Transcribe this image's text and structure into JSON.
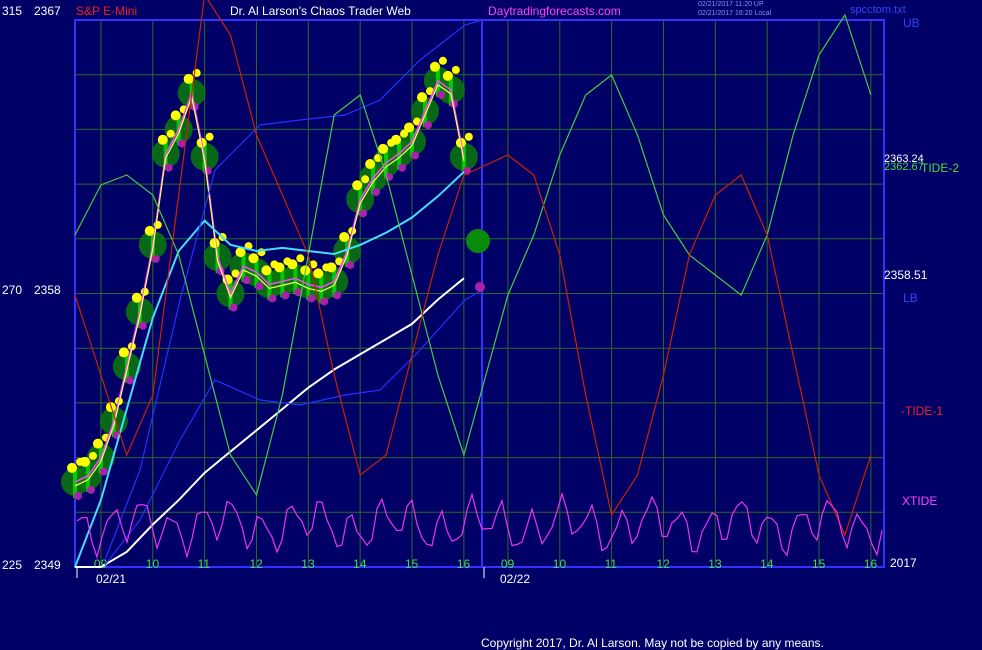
{
  "header": {
    "left_scale": "315",
    "left_price": "2367",
    "instrument": "S&P E-Mini",
    "site_title": "Dr. Al Larson's Chaos Trader Web",
    "site_link": "Daytradingforecasts.com",
    "timestamp_1": "02/21/2017 11:20 UP",
    "timestamp_2": "02/21/2017 16:20 Local",
    "file_name": "spcctom.txt"
  },
  "footer": {
    "copyright": "Copyright 2017, Dr. Al Larson. May not be copied by any means."
  },
  "colors": {
    "background": "#000066",
    "grid": "#2a6a2a",
    "frame": "#3333ff",
    "price_bar": "#00cc00",
    "price_dot": "#ffff00",
    "low_dot": "#aa22aa",
    "magenta_line": "#ff44ff",
    "cyan_line": "#44ddff",
    "white_line": "#ffffff",
    "tide_green": "#44cc44",
    "tide_red": "#cc2200",
    "xtide": "#ee33ee",
    "band_blue": "#2233ff"
  },
  "chart_data": {
    "type": "line",
    "title": "S&P E-Mini",
    "y_left_scale_labels": [
      "315",
      "270",
      "225"
    ],
    "y_left_price_labels": [
      "2367",
      "2358",
      "2349"
    ],
    "ylim": [
      2349,
      2367
    ],
    "hour_ticks": [
      "09",
      "10",
      "11",
      "12",
      "13",
      "14",
      "15",
      "16",
      "09",
      "10",
      "11",
      "12",
      "13",
      "14",
      "15",
      "16"
    ],
    "date_labels": [
      "02/21",
      "02/22"
    ],
    "right_year": "2017",
    "right_labels": {
      "ub": "UB",
      "lb": "LB",
      "tide2": "TIDE-2",
      "tide1": "-TIDE-1",
      "xtide": "XTIDE",
      "price_a": "2363.24",
      "price_b": "2362.67",
      "price_c": "2358.51"
    },
    "price_series": {
      "name": "S&P E-Mini",
      "x_hours": [
        8.5,
        8.75,
        9.0,
        9.25,
        9.5,
        9.75,
        10.0,
        10.25,
        10.5,
        10.75,
        11.0,
        11.25,
        11.5,
        11.75,
        12.0,
        12.25,
        12.5,
        12.75,
        13.0,
        13.25,
        13.5,
        13.75,
        14.0,
        14.25,
        14.5,
        14.75,
        15.0,
        15.25,
        15.5,
        15.75,
        16.0
      ],
      "values": [
        2351.8,
        2352.0,
        2352.6,
        2353.8,
        2355.6,
        2357.4,
        2359.6,
        2362.6,
        2363.4,
        2364.6,
        2362.5,
        2359.2,
        2358.0,
        2358.9,
        2358.7,
        2358.3,
        2358.4,
        2358.5,
        2358.3,
        2358.2,
        2358.4,
        2359.4,
        2361.1,
        2361.8,
        2362.3,
        2362.6,
        2363.0,
        2364.0,
        2365.0,
        2364.7,
        2362.5
      ]
    },
    "moving_averages": [
      {
        "x_hours": [
          8.5,
          9.0,
          9.5,
          10.0,
          10.5,
          11.0,
          11.5,
          12.0,
          12.5,
          13.0,
          13.5,
          14.0,
          14.5,
          15.0,
          15.5,
          16.0
        ],
        "values": [
          2349.0,
          2351.2,
          2354.2,
          2357.2,
          2359.4,
          2360.4,
          2359.6,
          2359.4,
          2359.5,
          2359.4,
          2359.3,
          2359.6,
          2360.0,
          2360.5,
          2361.2,
          2362.0
        ]
      },
      {
        "x_hours": [
          8.5,
          9.0,
          9.5,
          10.0,
          10.5,
          11.0,
          11.5,
          12.0,
          12.5,
          13.0,
          13.5,
          14.0,
          14.5,
          15.0,
          15.5,
          16.0
        ],
        "values": [
          2349.0,
          2349.0,
          2349.5,
          2350.4,
          2351.2,
          2352.1,
          2352.8,
          2353.5,
          2354.2,
          2354.9,
          2355.5,
          2356.0,
          2356.5,
          2357.0,
          2357.8,
          2358.5
        ]
      }
    ],
    "tide_forecasts": [
      {
        "name": "TIDE-2",
        "x_hours": [
          8.5,
          9.0,
          9.5,
          10.0,
          10.5,
          11.0,
          11.5,
          12.0,
          12.5,
          13.0,
          13.5,
          14.0,
          14.5,
          15.0,
          15.5,
          16.0,
          9.0,
          9.5,
          10.0,
          10.5,
          11.0,
          11.5,
          12.0,
          12.5,
          13.0,
          13.5,
          14.0,
          14.5,
          15.0,
          15.5,
          16.0
        ],
        "values": [
          0.3,
          0.55,
          0.6,
          0.5,
          0.2,
          -0.3,
          -0.8,
          -1.0,
          -0.5,
          0.2,
          0.9,
          1.0,
          0.6,
          0.1,
          -0.4,
          -0.8,
          0.0,
          0.3,
          0.7,
          1.0,
          1.1,
          0.8,
          0.4,
          0.2,
          0.1,
          0.0,
          0.3,
          0.8,
          1.2,
          1.4,
          1.0
        ]
      },
      {
        "name": "-TIDE-1",
        "values": [
          0.0,
          -0.4,
          -0.8,
          -0.5,
          0.5,
          1.5,
          1.3,
          0.8,
          0.5,
          0.2,
          -0.4,
          -0.9,
          -0.8,
          -0.3,
          0.2,
          0.6,
          0.7,
          0.6,
          0.2,
          -0.5,
          -1.1,
          -0.9,
          -0.4,
          0.2,
          0.5,
          0.6,
          0.3,
          -0.3,
          -0.9,
          -1.2,
          -0.8
        ]
      },
      {
        "name": "XTIDE"
      }
    ]
  }
}
